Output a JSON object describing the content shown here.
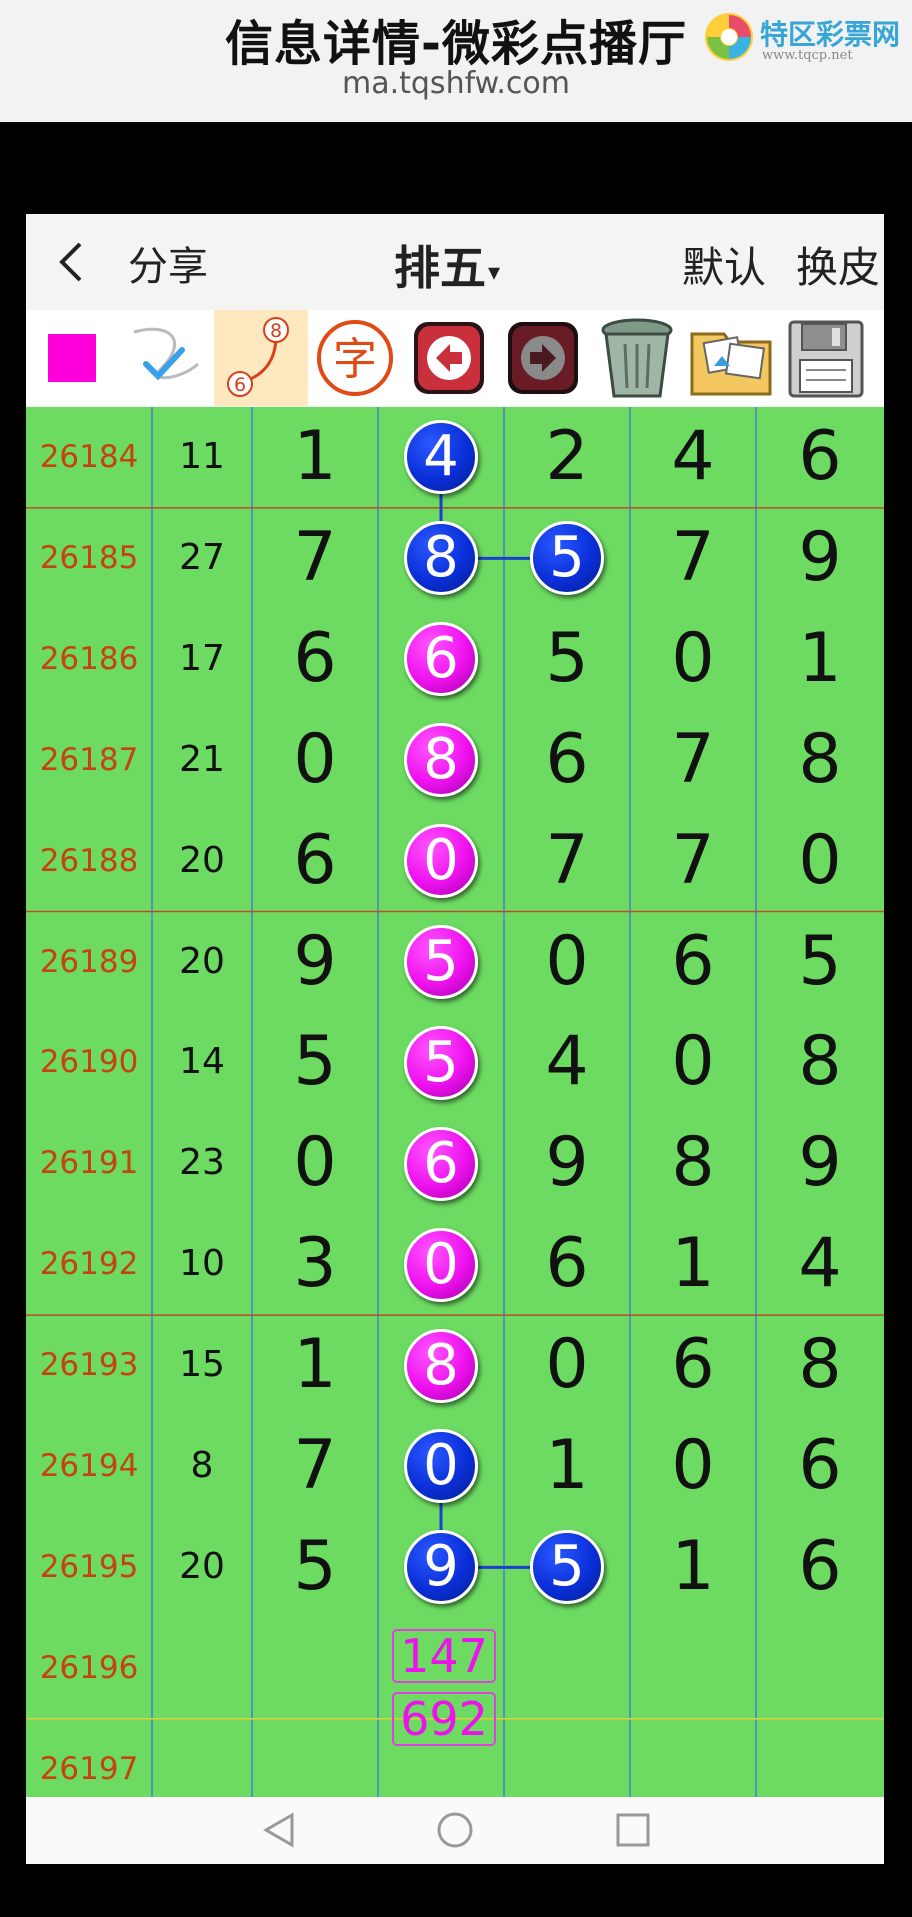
{
  "header": {
    "title": "信息详情-微彩点播厅",
    "url": "ma.tqshfw.com",
    "logo_text": "特区彩票网",
    "logo_sub": "www.tqcp.net"
  },
  "nav": {
    "back": "back-icon",
    "share_label": "分享",
    "lottery_label": "排五",
    "caret": "▾",
    "skin_default": "默认",
    "skin_change": "换皮"
  },
  "toolbar": {
    "items": [
      "magenta-color-swatch",
      "pen-curve-icon",
      "dot-link-icon",
      "character-icon",
      "undo-arrow-icon",
      "redo-arrow-icon",
      "trash-icon",
      "photos-folder-icon",
      "save-floppy-icon"
    ],
    "dot_link_numbers": [
      "8",
      "6"
    ],
    "character_glyph": "字"
  },
  "rows": [
    {
      "issue": "26184",
      "sum": "11",
      "d": [
        "1",
        "4",
        "2",
        "4",
        "6"
      ]
    },
    {
      "issue": "26185",
      "sum": "27",
      "d": [
        "7",
        "8",
        "5",
        "7",
        "9"
      ]
    },
    {
      "issue": "26186",
      "sum": "17",
      "d": [
        "6",
        "6",
        "5",
        "0",
        "1"
      ]
    },
    {
      "issue": "26187",
      "sum": "21",
      "d": [
        "0",
        "8",
        "6",
        "7",
        "8"
      ]
    },
    {
      "issue": "26188",
      "sum": "20",
      "d": [
        "6",
        "0",
        "7",
        "7",
        "0"
      ]
    },
    {
      "issue": "26189",
      "sum": "20",
      "d": [
        "9",
        "5",
        "0",
        "6",
        "5"
      ]
    },
    {
      "issue": "26190",
      "sum": "14",
      "d": [
        "5",
        "5",
        "4",
        "0",
        "8"
      ]
    },
    {
      "issue": "26191",
      "sum": "23",
      "d": [
        "0",
        "6",
        "9",
        "8",
        "9"
      ]
    },
    {
      "issue": "26192",
      "sum": "10",
      "d": [
        "3",
        "0",
        "6",
        "1",
        "4"
      ]
    },
    {
      "issue": "26193",
      "sum": "15",
      "d": [
        "1",
        "8",
        "0",
        "6",
        "8"
      ]
    },
    {
      "issue": "26194",
      "sum": "8",
      "d": [
        "7",
        "0",
        "1",
        "0",
        "6"
      ]
    },
    {
      "issue": "26195",
      "sum": "20",
      "d": [
        "5",
        "9",
        "5",
        "1",
        "6"
      ]
    },
    {
      "issue": "26196",
      "sum": "",
      "d": [
        "",
        "",
        "",
        "",
        ""
      ]
    },
    {
      "issue": "26197",
      "sum": "",
      "d": [
        "",
        "",
        "",
        "",
        ""
      ]
    }
  ],
  "highlights": [
    {
      "row": 0,
      "col": 1,
      "color": "blue"
    },
    {
      "row": 1,
      "col": 1,
      "color": "blue"
    },
    {
      "row": 1,
      "col": 2,
      "color": "blue"
    },
    {
      "row": 2,
      "col": 1,
      "color": "pink"
    },
    {
      "row": 3,
      "col": 1,
      "color": "pink"
    },
    {
      "row": 4,
      "col": 1,
      "color": "pink"
    },
    {
      "row": 5,
      "col": 1,
      "color": "pink"
    },
    {
      "row": 6,
      "col": 1,
      "color": "pink"
    },
    {
      "row": 7,
      "col": 1,
      "color": "pink"
    },
    {
      "row": 8,
      "col": 1,
      "color": "pink"
    },
    {
      "row": 9,
      "col": 1,
      "color": "pink"
    },
    {
      "row": 10,
      "col": 1,
      "color": "blue"
    },
    {
      "row": 11,
      "col": 1,
      "color": "blue"
    },
    {
      "row": 11,
      "col": 2,
      "color": "blue"
    }
  ],
  "links": [
    {
      "from": [
        0,
        1
      ],
      "to": [
        1,
        1
      ]
    },
    {
      "from": [
        1,
        1
      ],
      "to": [
        1,
        2
      ]
    },
    {
      "from": [
        10,
        1
      ],
      "to": [
        11,
        1
      ]
    },
    {
      "from": [
        11,
        1
      ],
      "to": [
        11,
        2
      ]
    }
  ],
  "predictions": [
    "147",
    "692"
  ],
  "colors": {
    "grid_bg": "#6ddb62",
    "issue_text": "#c4440e",
    "ball_blue": "#0a2fd8",
    "ball_pink": "#ee11ee"
  },
  "floating": {
    "add": "add-icon",
    "scroll": "scroll-handle-icon"
  },
  "system_nav": [
    "back-triangle-icon",
    "home-circle-icon",
    "recents-square-icon"
  ]
}
